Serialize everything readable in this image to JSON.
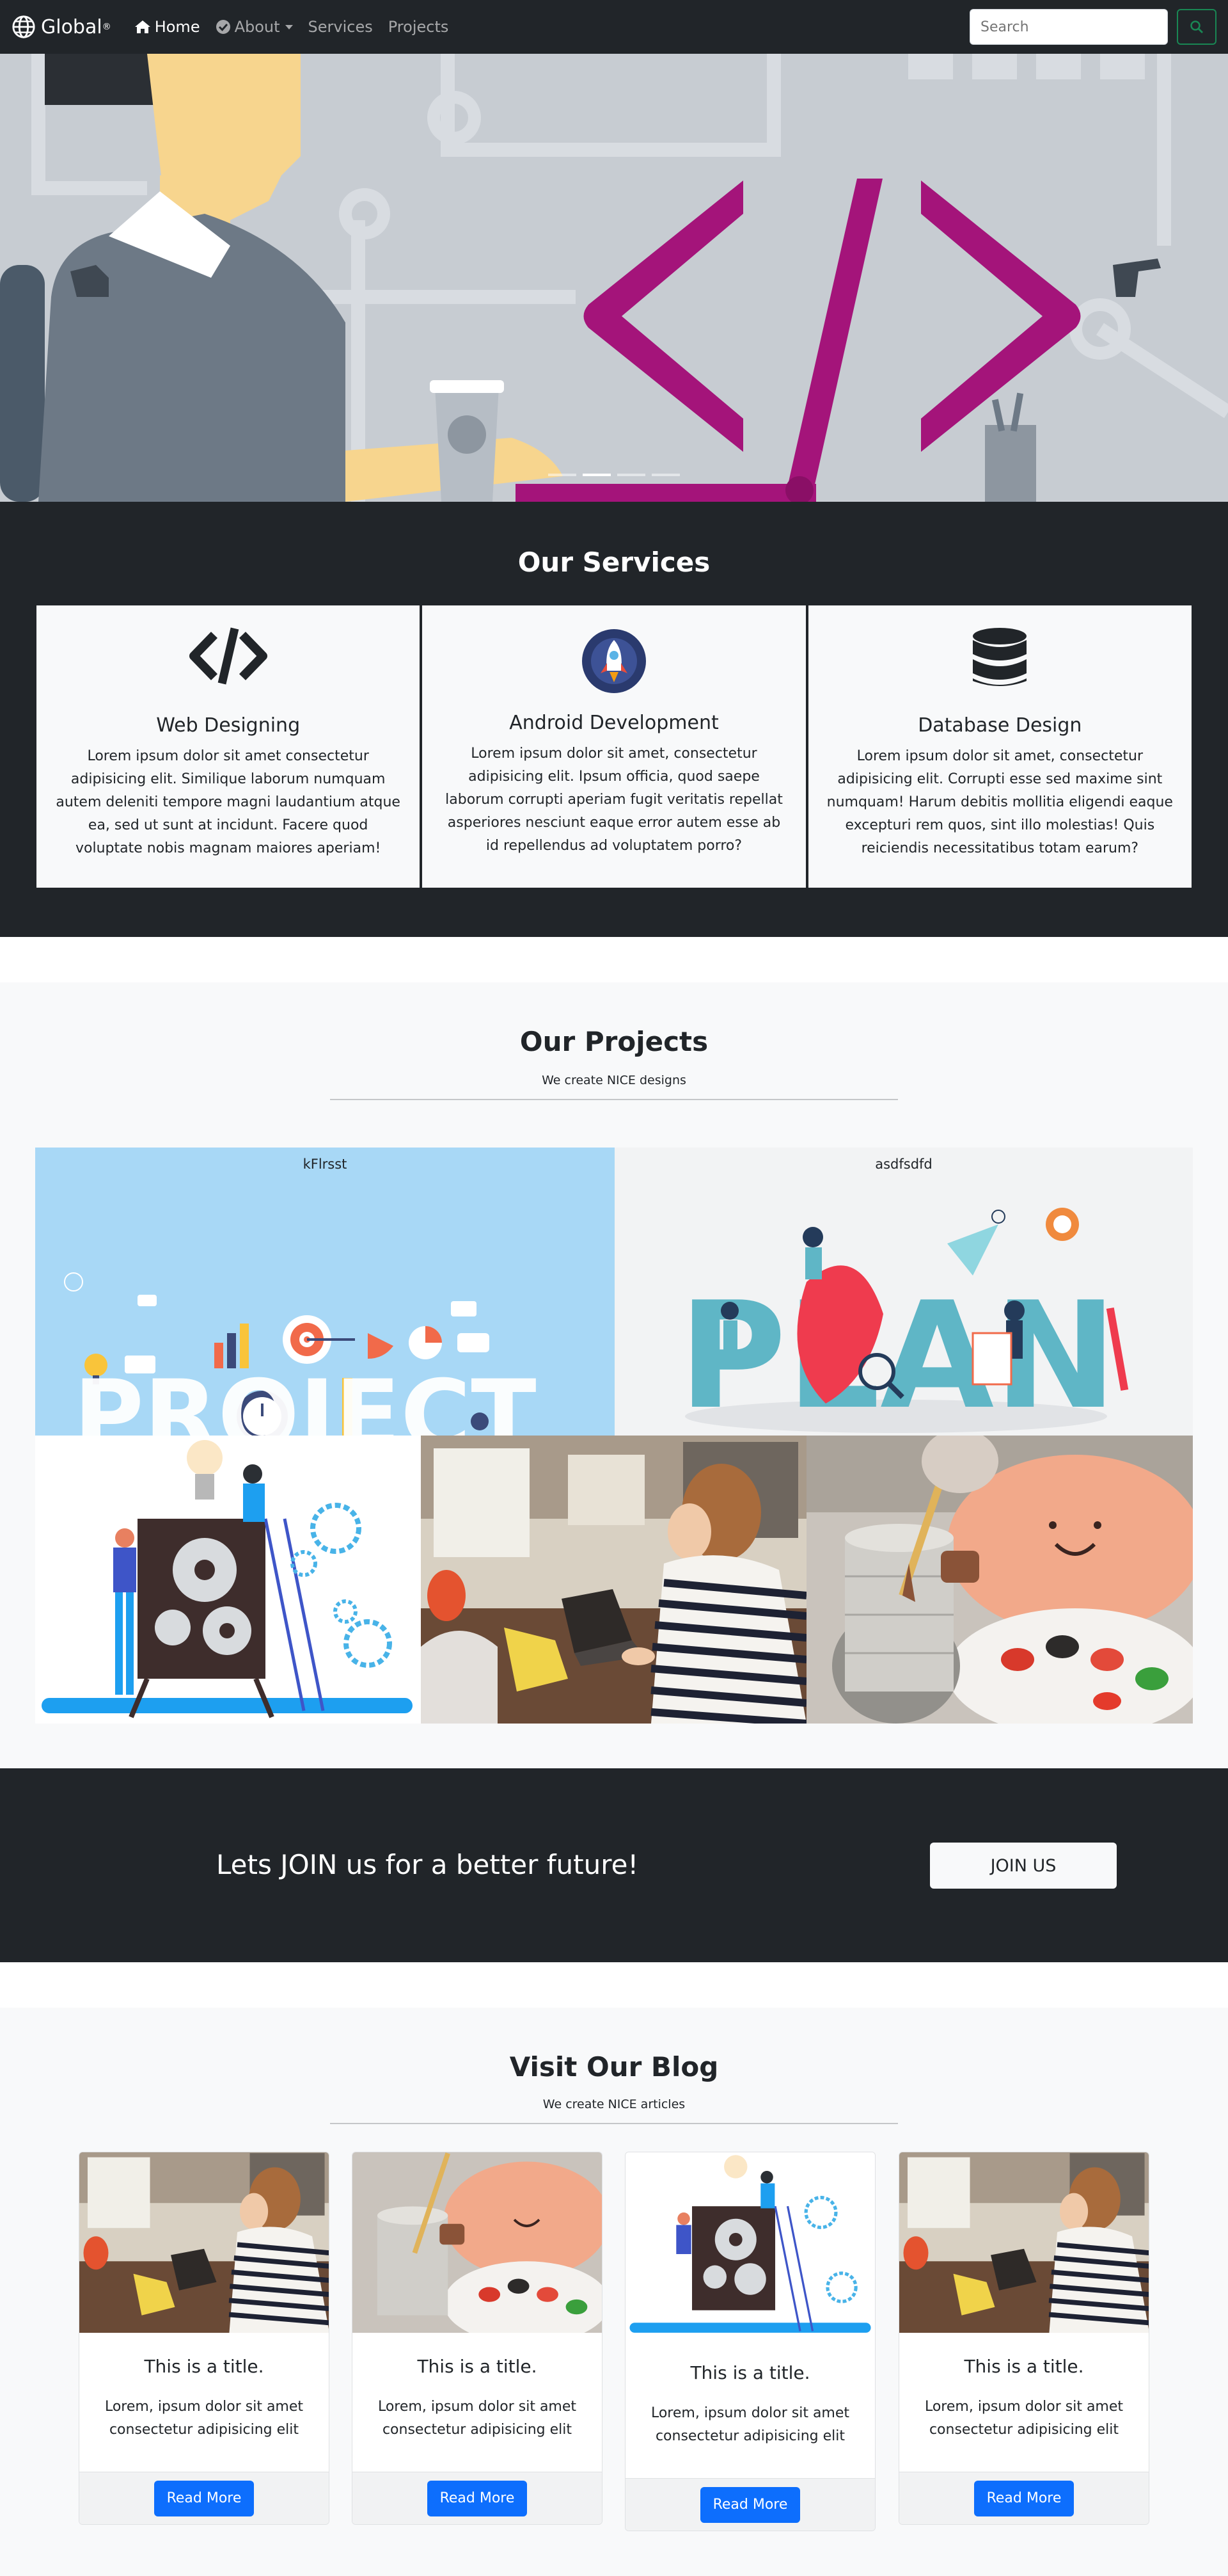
{
  "navbar": {
    "brand": "Global",
    "brand_mark": "®",
    "links": [
      {
        "label": "Home",
        "icon": "home-icon",
        "active": true
      },
      {
        "label": "About",
        "icon": "check-circle-icon",
        "dropdown": true
      },
      {
        "label": "Services"
      },
      {
        "label": "Projects"
      }
    ],
    "search_placeholder": "Search",
    "search_icon": "search-icon"
  },
  "hero": {
    "slides": 4,
    "active_slide": 2,
    "illustration": "developer-coding-illustration",
    "code_symbol_color": "#a4147a"
  },
  "services": {
    "title": "Our Services",
    "items": [
      {
        "icon": "code-icon",
        "title": "Web Designing",
        "text": "Lorem ipsum dolor sit amet consectetur adipisicing elit. Similique laborum numquam autem deleniti tempore magni laudantium atque ea, sed ut sunt at incidunt. Facere quod voluptate nobis magnam maiores aperiam!"
      },
      {
        "icon": "rocket-icon",
        "title": "Android Development",
        "text": "Lorem ipsum dolor sit amet, consectetur adipisicing elit. Ipsum officia, quod saepe laborum corrupti aperiam fugit veritatis repellat asperiores nesciunt eaque error autem esse ab id repellendus ad voluptatem porro?"
      },
      {
        "icon": "database-icon",
        "title": "Database Design",
        "text": "Lorem ipsum dolor sit amet, consectetur adipisicing elit. Corrupti esse sed maxime sint numquam! Harum debitis mollitia eligendi eaque excepturi rem quos, sint illo molestias! Quis reiciendis necessitatibus totam earum?"
      }
    ]
  },
  "projects": {
    "title": "Our Projects",
    "subtitle": "We create NICE designs",
    "items": [
      {
        "caption": "kFlrsst",
        "image": "project-illustration"
      },
      {
        "caption": "asdfsdfd",
        "image": "plan-illustration"
      },
      {
        "caption": "",
        "image": "gears-team-illustration"
      },
      {
        "caption": "",
        "image": "woman-laptop-photo"
      },
      {
        "caption": "",
        "image": "paint-palette-photo"
      }
    ]
  },
  "join": {
    "text": "Lets JOIN us for a better future!",
    "button": "JOIN US"
  },
  "blog": {
    "title": "Visit Our Blog",
    "subtitle": "We create NICE articles",
    "posts": [
      {
        "image": "woman-laptop-photo",
        "title": "This is a title.",
        "text": "Lorem, ipsum dolor sit amet consectetur adipisicing elit",
        "button": "Read More"
      },
      {
        "image": "paint-palette-photo",
        "title": "This is a title.",
        "text": "Lorem, ipsum dolor sit amet consectetur adipisicing elit",
        "button": "Read More"
      },
      {
        "image": "gears-team-illustration",
        "title": "This is a title.",
        "text": "Lorem, ipsum dolor sit amet consectetur adipisicing elit",
        "button": "Read More"
      },
      {
        "image": "woman-laptop-photo",
        "title": "This is a title.",
        "text": "Lorem, ipsum dolor sit amet consectetur adipisicing elit",
        "button": "Read More"
      }
    ]
  },
  "colors": {
    "dark": "#212529",
    "light": "#f8f9fa",
    "primary": "#0d6efd",
    "success": "#198754"
  }
}
